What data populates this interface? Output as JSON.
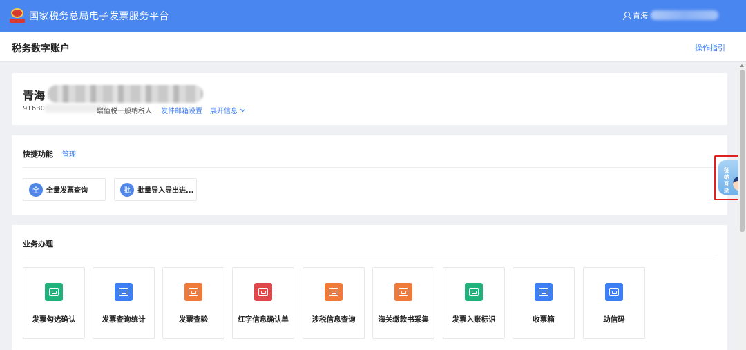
{
  "header": {
    "app_title": "国家税务总局电子发票服务平台",
    "user_prefix": "青海",
    "logo_icon": "tax-emblem-icon",
    "user_icon": "person-icon"
  },
  "subheader": {
    "title": "税务数字账户",
    "guide_link": "操作指引"
  },
  "company": {
    "name_prefix": "青海",
    "taxid_prefix": "91630",
    "tax_type": "增值税一般纳税人",
    "mail_setting": "发件邮箱设置",
    "expand": "展开信息"
  },
  "quick": {
    "title": "快捷功能",
    "manage": "管理",
    "items": [
      {
        "badge": "全",
        "label": "全量发票查询"
      },
      {
        "badge": "批",
        "label": "批量导入导出进..."
      }
    ]
  },
  "business": {
    "title": "业务办理",
    "tiles": [
      {
        "label": "发票勾选确认",
        "icon": "ticket-icon",
        "color": "#20b27a"
      },
      {
        "label": "发票查询统计",
        "icon": "search-doc-icon",
        "color": "#3d7ff5"
      },
      {
        "label": "发票查验",
        "icon": "verify-ticket-icon",
        "color": "#f07a3a"
      },
      {
        "label": "红字信息确认单",
        "icon": "red-doc-icon",
        "color": "#e0484c"
      },
      {
        "label": "涉税信息查询",
        "icon": "tax-search-icon",
        "color": "#f07a3a"
      },
      {
        "label": "海关缴款书采集",
        "icon": "customs-doc-icon",
        "color": "#f07a3a"
      },
      {
        "label": "发票入账标识",
        "icon": "account-mark-icon",
        "color": "#20b27a"
      },
      {
        "label": "收票箱",
        "icon": "mailbox-icon",
        "color": "#3d7ff5"
      },
      {
        "label": "助信码",
        "icon": "qrcode-icon",
        "color": "#3d7ff5"
      }
    ]
  },
  "helper": {
    "text": "征纳互动",
    "icon": "assistant-avatar-icon"
  }
}
